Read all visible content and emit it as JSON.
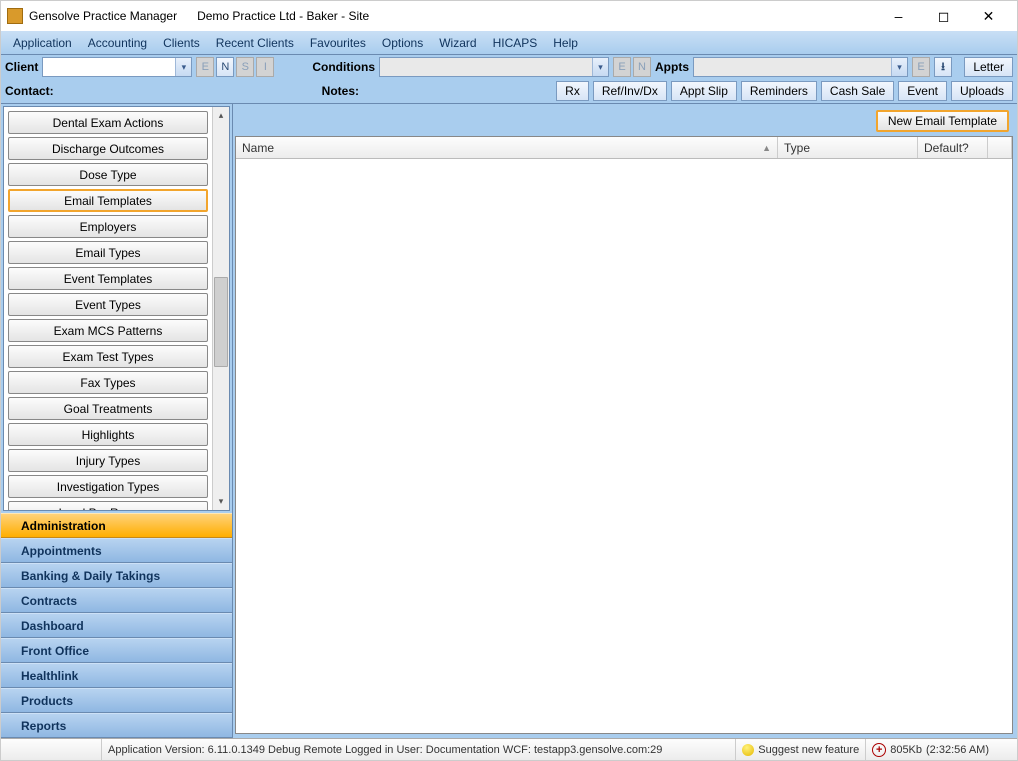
{
  "title": {
    "app_name": "Gensolve Practice Manager",
    "context": "Demo Practice Ltd - Baker -  Site"
  },
  "menubar": [
    "Application",
    "Accounting",
    "Clients",
    "Recent Clients",
    "Favourites",
    "Options",
    "Wizard",
    "HICAPS",
    "Help"
  ],
  "toolbar": {
    "client_label": "Client",
    "tiny1": [
      "E",
      "N",
      "S",
      "I"
    ],
    "conditions_label": "Conditions",
    "tiny2": [
      "E",
      "N"
    ],
    "appts_label": "Appts",
    "appt_e": "E",
    "download_glyph": "⭳",
    "letter": "Letter",
    "contact_label": "Contact:",
    "notes_label": "Notes:",
    "actions": [
      "Rx",
      "Ref/Inv/Dx",
      "Appt Slip",
      "Reminders",
      "Cash Sale",
      "Event",
      "Uploads"
    ]
  },
  "sidebar": {
    "buttons": [
      "Dental Exam Actions",
      "Discharge Outcomes",
      "Dose Type",
      "Email Templates",
      "Employers",
      "Email Types",
      "Event Templates",
      "Event Types",
      "Exam MCS Patterns",
      "Exam Test Types",
      "Fax Types",
      "Goal Treatments",
      "Highlights",
      "Injury Types",
      "Investigation Types",
      "Lead Prv Reasons"
    ],
    "highlight_index": 3,
    "nav": [
      "Administration",
      "Appointments",
      "Banking & Daily Takings",
      "Contracts",
      "Dashboard",
      "Front Office",
      "Healthlink",
      "Products",
      "Reports"
    ],
    "nav_active_index": 0
  },
  "content": {
    "new_btn_label": "New Email Template",
    "columns": {
      "name": "Name",
      "type": "Type",
      "default": "Default?"
    }
  },
  "statusbar": {
    "app_version": "Application Version: 6.11.0.1349 Debug Remote  Logged in User: Documentation WCF: testapp3.gensolve.com:29",
    "suggest": "Suggest new feature",
    "mem": "805Kb",
    "time": "(2:32:56 AM)"
  }
}
